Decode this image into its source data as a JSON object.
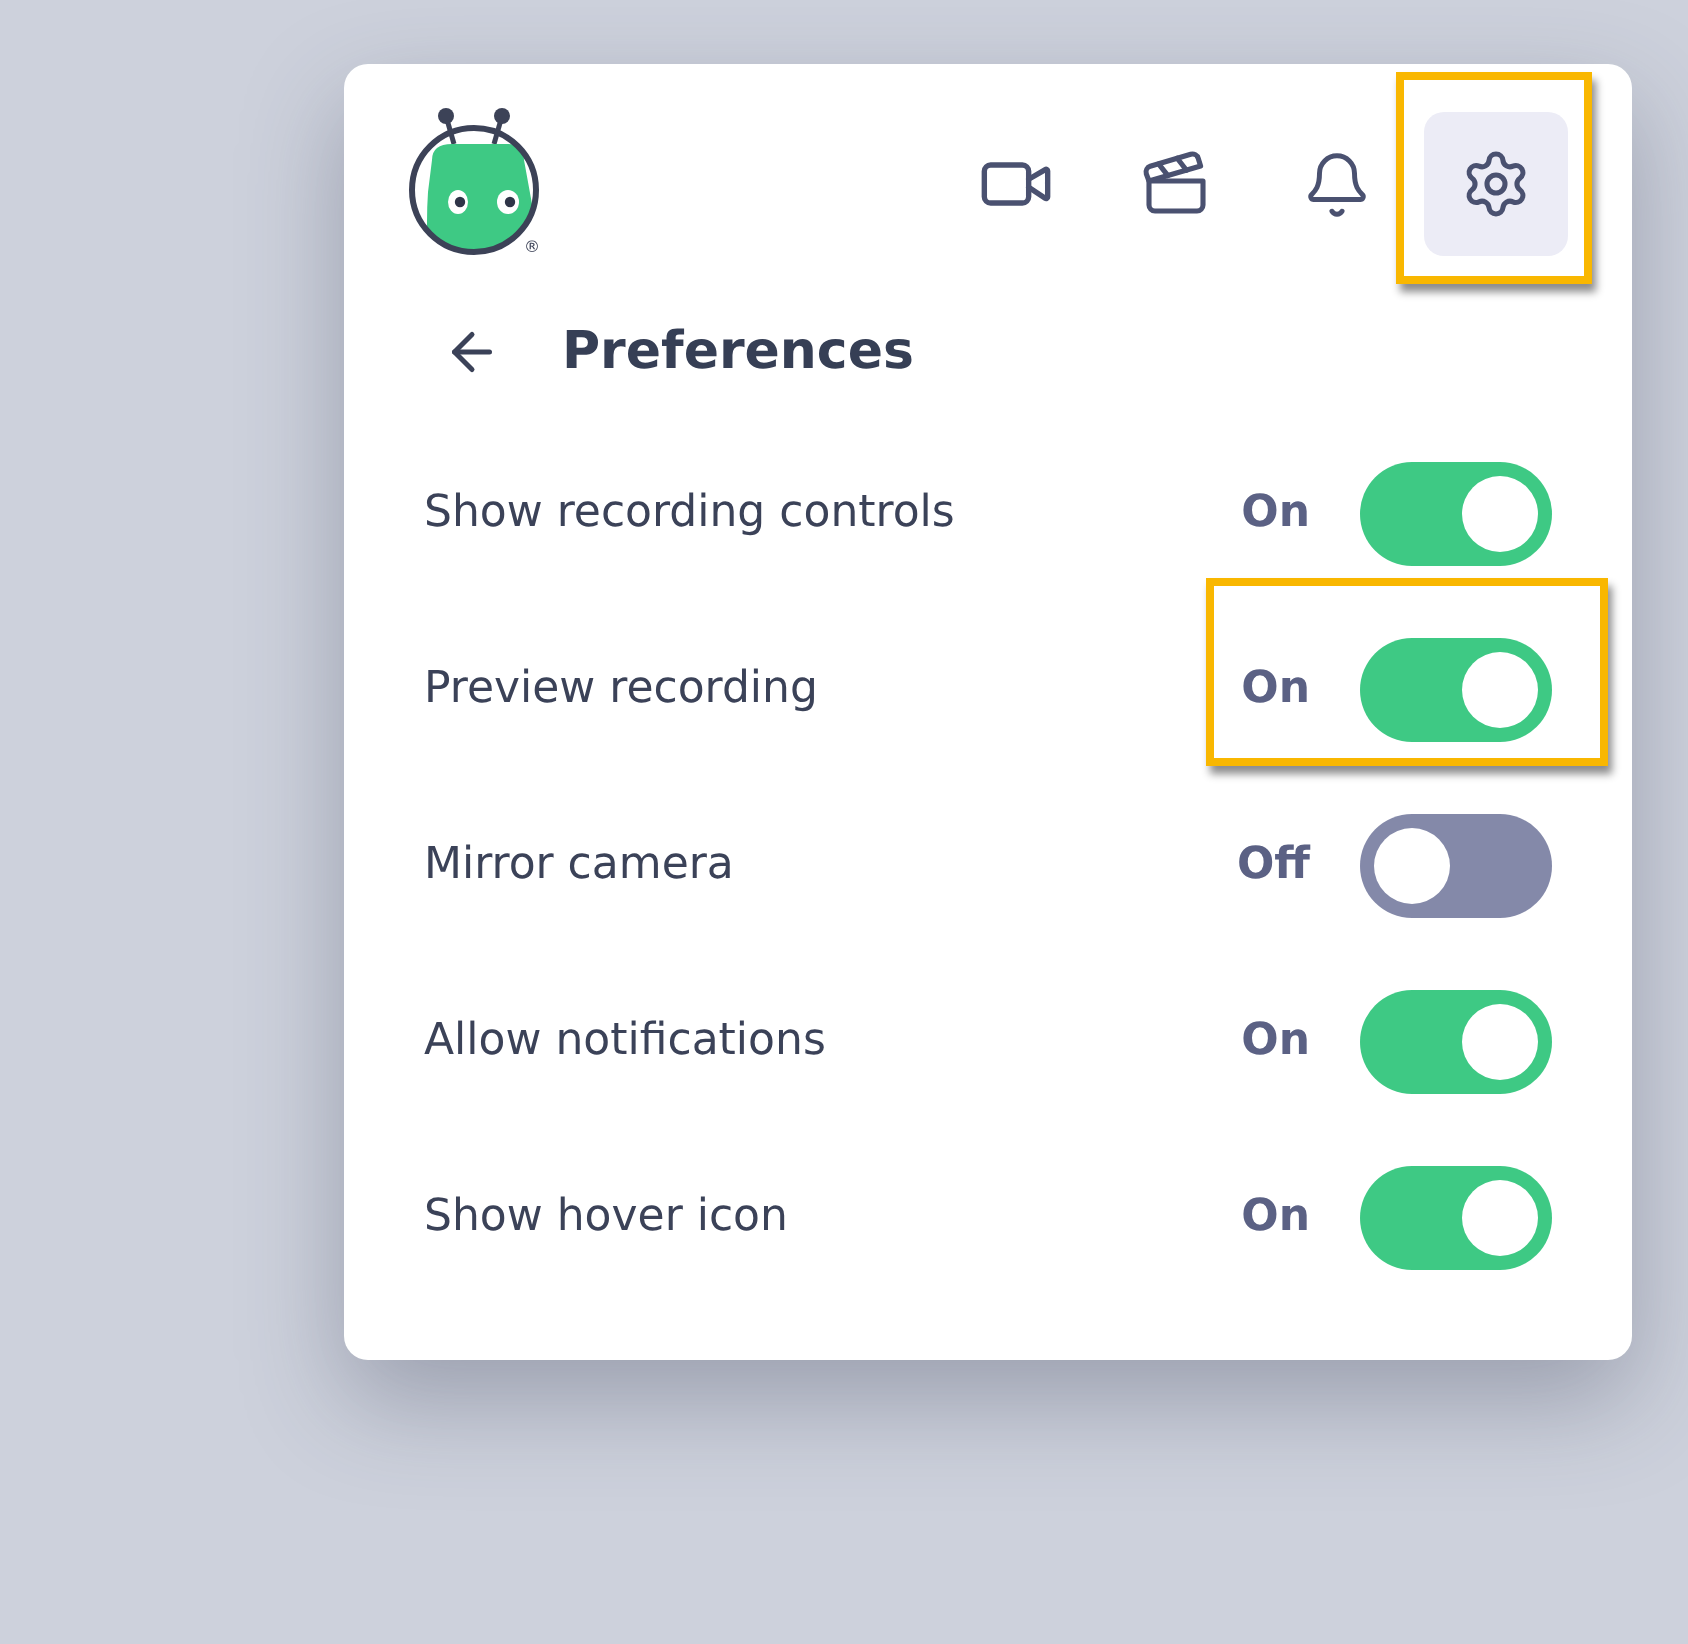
{
  "header": {
    "logo": {
      "registered_mark": "®"
    },
    "toolbar": [
      {
        "kind": "video",
        "selected": false,
        "highlighted": false
      },
      {
        "kind": "recordings",
        "selected": false,
        "highlighted": false
      },
      {
        "kind": "notifications",
        "selected": false,
        "highlighted": false
      },
      {
        "kind": "settings",
        "selected": true,
        "highlighted": true
      }
    ]
  },
  "page": {
    "title": "Preferences"
  },
  "settings": [
    {
      "label": "Show recording controls",
      "status": "On",
      "on": true,
      "highlighted": false
    },
    {
      "label": "Preview recording",
      "status": "On",
      "on": true,
      "highlighted": true
    },
    {
      "label": "Mirror camera",
      "status": "Off",
      "on": false,
      "highlighted": false
    },
    {
      "label": "Allow notifications",
      "status": "On",
      "on": true,
      "highlighted": false
    },
    {
      "label": "Show hover icon",
      "status": "On",
      "on": true,
      "highlighted": false
    }
  ]
}
